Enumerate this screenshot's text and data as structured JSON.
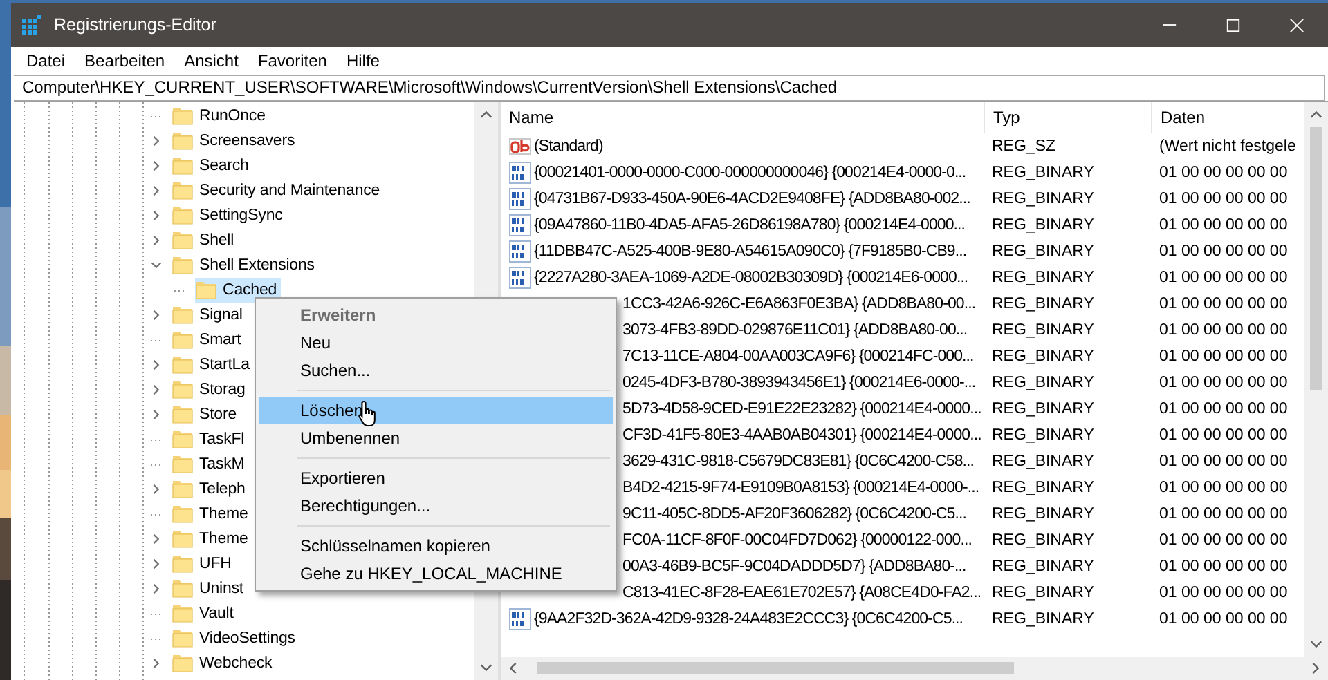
{
  "window": {
    "title": "Registrierungs-Editor"
  },
  "menu_bar": [
    "Datei",
    "Bearbeiten",
    "Ansicht",
    "Favoriten",
    "Hilfe"
  ],
  "address": "Computer\\HKEY_CURRENT_USER\\SOFTWARE\\Microsoft\\Windows\\CurrentVersion\\Shell Extensions\\Cached",
  "tree": [
    {
      "label": "RunOnce",
      "expandable": false,
      "selected": false
    },
    {
      "label": "Screensavers",
      "expandable": true,
      "expanded": false,
      "selected": false
    },
    {
      "label": "Search",
      "expandable": true,
      "expanded": false,
      "selected": false
    },
    {
      "label": "Security and Maintenance",
      "expandable": true,
      "expanded": false,
      "selected": false
    },
    {
      "label": "SettingSync",
      "expandable": true,
      "expanded": false,
      "selected": false
    },
    {
      "label": "Shell",
      "expandable": true,
      "expanded": false,
      "selected": false
    },
    {
      "label": "Shell Extensions",
      "expandable": true,
      "expanded": true,
      "selected": false,
      "children": [
        {
          "label": "Cached",
          "expandable": false,
          "selected": true
        }
      ]
    },
    {
      "label": "Signal",
      "expandable": true,
      "expanded": false,
      "selected": false
    },
    {
      "label": "Smart",
      "expandable": false,
      "selected": false
    },
    {
      "label": "StartLa",
      "expandable": true,
      "expanded": false,
      "selected": false
    },
    {
      "label": "Storag",
      "expandable": true,
      "expanded": false,
      "selected": false
    },
    {
      "label": "Store",
      "expandable": true,
      "expanded": false,
      "selected": false
    },
    {
      "label": "TaskFl",
      "expandable": false,
      "selected": false
    },
    {
      "label": "TaskM",
      "expandable": false,
      "selected": false
    },
    {
      "label": "Teleph",
      "expandable": true,
      "expanded": false,
      "selected": false
    },
    {
      "label": "Theme",
      "expandable": false,
      "selected": false
    },
    {
      "label": "Theme",
      "expandable": true,
      "expanded": false,
      "selected": false
    },
    {
      "label": "UFH",
      "expandable": true,
      "expanded": false,
      "selected": false
    },
    {
      "label": "Uninst",
      "expandable": true,
      "expanded": false,
      "selected": false
    },
    {
      "label": "Vault",
      "expandable": false,
      "selected": false
    },
    {
      "label": "VideoSettings",
      "expandable": false,
      "selected": false
    },
    {
      "label": "Webcheck",
      "expandable": true,
      "expanded": false,
      "selected": false
    }
  ],
  "table": {
    "columns": [
      "Name",
      "Typ",
      "Daten"
    ],
    "rows": [
      {
        "kind": "string",
        "name": "(Standard)",
        "type": "REG_SZ",
        "data": "(Wert nicht festgele"
      },
      {
        "kind": "binary",
        "name": "{00021401-0000-0000-C000-000000000046} {000214E4-0000-0...",
        "type": "REG_BINARY",
        "data": "01 00 00 00 00 00"
      },
      {
        "kind": "binary",
        "name": "{04731B67-D933-450A-90E6-4ACD2E9408FE} {ADD8BA80-002...",
        "type": "REG_BINARY",
        "data": "01 00 00 00 00 00"
      },
      {
        "kind": "binary",
        "name": "{09A47860-11B0-4DA5-AFA5-26D86198A780} {000214E4-0000...",
        "type": "REG_BINARY",
        "data": "01 00 00 00 00 00"
      },
      {
        "kind": "binary",
        "name": "{11DBB47C-A525-400B-9E80-A54615A090C0} {7F9185B0-CB9...",
        "type": "REG_BINARY",
        "data": "01 00 00 00 00 00"
      },
      {
        "kind": "binary",
        "name": "{2227A280-3AEA-1069-A2DE-08002B30309D} {000214E6-0000...",
        "type": "REG_BINARY",
        "data": "01 00 00 00 00 00"
      },
      {
        "kind": "covered",
        "name": "1CC3-42A6-926C-E6A863F0E3BA} {ADD8BA80-00...",
        "type": "REG_BINARY",
        "data": "01 00 00 00 00 00"
      },
      {
        "kind": "covered",
        "name": "3073-4FB3-89DD-029876E11C01} {ADD8BA80-00...",
        "type": "REG_BINARY",
        "data": "01 00 00 00 00 00"
      },
      {
        "kind": "covered",
        "name": "7C13-11CE-A804-00AA003CA9F6} {000214FC-000...",
        "type": "REG_BINARY",
        "data": "01 00 00 00 00 00"
      },
      {
        "kind": "covered",
        "name": "0245-4DF3-B780-3893943456E1} {000214E6-0000-...",
        "type": "REG_BINARY",
        "data": "01 00 00 00 00 00"
      },
      {
        "kind": "covered",
        "name": "5D73-4D58-9CED-E91E22E23282} {000214E4-0000...",
        "type": "REG_BINARY",
        "data": "01 00 00 00 00 00"
      },
      {
        "kind": "covered",
        "name": "CF3D-41F5-80E3-4AAB0AB04301} {000214E4-0000...",
        "type": "REG_BINARY",
        "data": "01 00 00 00 00 00"
      },
      {
        "kind": "covered",
        "name": "3629-431C-9818-C5679DC83E81} {0C6C4200-C58...",
        "type": "REG_BINARY",
        "data": "01 00 00 00 00 00"
      },
      {
        "kind": "covered",
        "name": "B4D2-4215-9F74-E9109B0A8153} {000214E4-0000-...",
        "type": "REG_BINARY",
        "data": "01 00 00 00 00 00"
      },
      {
        "kind": "covered",
        "name": "9C11-405C-8DD5-AF20F3606282} {0C6C4200-C5...",
        "type": "REG_BINARY",
        "data": "01 00 00 00 00 00"
      },
      {
        "kind": "covered",
        "name": "FC0A-11CF-8F0F-00C04FD7D062} {00000122-000...",
        "type": "REG_BINARY",
        "data": "01 00 00 00 00 00"
      },
      {
        "kind": "covered",
        "name": "00A3-46B9-BC5F-9C04DADDD5D7} {ADD8BA80-...",
        "type": "REG_BINARY",
        "data": "01 00 00 00 00 00"
      },
      {
        "kind": "covered",
        "name": "C813-41EC-8F28-EAE61E702E57} {A08CE4D0-FA2...",
        "type": "REG_BINARY",
        "data": "01 00 00 00 00 00"
      },
      {
        "kind": "binary",
        "name": "{9AA2F32D-362A-42D9-9328-24A483E2CCC3} {0C6C4200-C5...",
        "type": "REG_BINARY",
        "data": "01 00 00 00 00 00"
      }
    ]
  },
  "context_menu": [
    {
      "kind": "item",
      "label": "Erweitern",
      "default": true,
      "disabled": true,
      "selected": false
    },
    {
      "kind": "item",
      "label": "Neu",
      "default": false,
      "disabled": false,
      "selected": false
    },
    {
      "kind": "item",
      "label": "Suchen...",
      "default": false,
      "disabled": false,
      "selected": false
    },
    {
      "kind": "separator"
    },
    {
      "kind": "item",
      "label": "Löschen",
      "default": false,
      "disabled": false,
      "selected": true
    },
    {
      "kind": "item",
      "label": "Umbenennen",
      "default": false,
      "disabled": false,
      "selected": false
    },
    {
      "kind": "separator"
    },
    {
      "kind": "item",
      "label": "Exportieren",
      "default": false,
      "disabled": false,
      "selected": false
    },
    {
      "kind": "item",
      "label": "Berechtigungen...",
      "default": false,
      "disabled": false,
      "selected": false
    },
    {
      "kind": "separator"
    },
    {
      "kind": "item",
      "label": "Schlüsselnamen kopieren",
      "default": false,
      "disabled": false,
      "selected": false
    },
    {
      "kind": "item",
      "label": "Gehe zu HKEY_LOCAL_MACHINE",
      "default": false,
      "disabled": false,
      "selected": false
    }
  ]
}
